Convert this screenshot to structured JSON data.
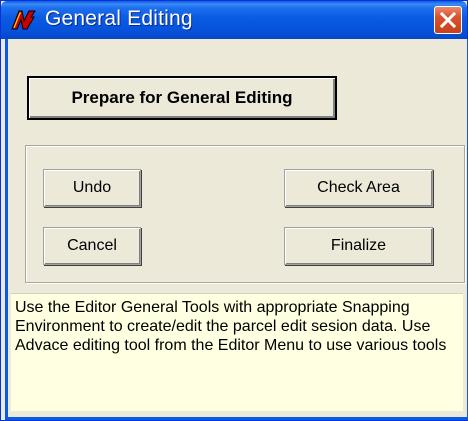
{
  "window": {
    "title": "General Editing",
    "icon": "app-logo-icon",
    "close_icon": "close-icon",
    "accent_color": "#0a5ae2",
    "close_color": "#d9502c"
  },
  "main": {
    "prepare_label": "Prepare for General Editing",
    "undo_label": "Undo",
    "check_area_label": "Check Area",
    "cancel_label": "Cancel",
    "finalize_label": "Finalize"
  },
  "info": {
    "text": "Use the Editor General Tools with appropriate Snapping Environment to create/edit the parcel edit sesion data.  Use Advace editing tool from the Editor Menu to use various tools",
    "background_color": "#ffffe1"
  }
}
